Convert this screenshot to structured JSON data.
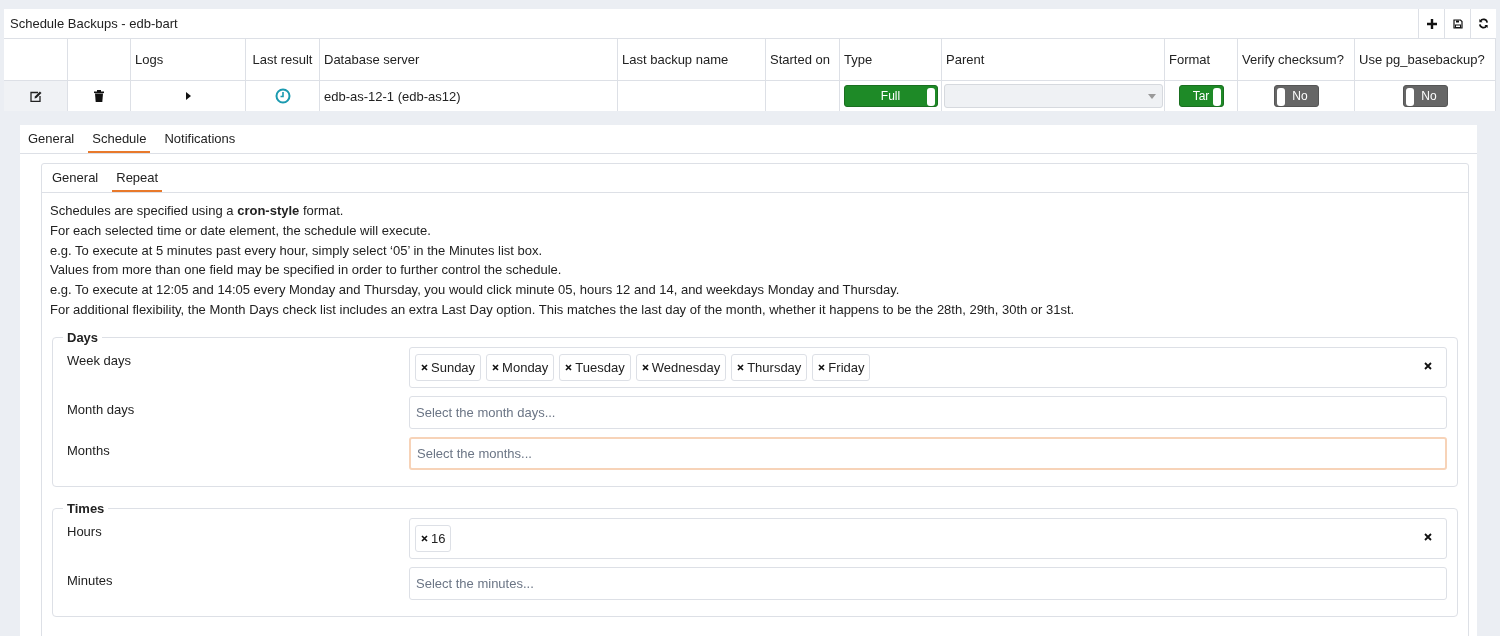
{
  "panel": {
    "title": "Schedule Backups - edb-bart"
  },
  "table": {
    "columns": [
      "Logs",
      "Last result",
      "Database server",
      "Last backup name",
      "Started on",
      "Type",
      "Parent",
      "Format",
      "Verify checksum?",
      "Use pg_basebackup?"
    ],
    "row": {
      "server": "edb-as-12-1 (edb-as12)",
      "type": {
        "label": "Full",
        "on": true
      },
      "parent": {
        "disabled": true
      },
      "format": {
        "label": "Tar",
        "on": true
      },
      "verify_checksum": {
        "label": "No",
        "on": false
      },
      "use_pg_basebackup": {
        "label": "No",
        "on": false
      }
    }
  },
  "tabs": [
    {
      "label": "General",
      "selected": false
    },
    {
      "label": "Schedule",
      "selected": true
    },
    {
      "label": "Notifications",
      "selected": false
    }
  ],
  "subtabs": [
    {
      "label": "General",
      "selected": false
    },
    {
      "label": "Repeat",
      "selected": true
    }
  ],
  "description": [
    "Schedules are specified using a **cron-style** format.",
    "For each selected time or date element, the schedule will execute.",
    "e.g. To execute at 5 minutes past every hour, simply select ‘05’ in the Minutes list box.",
    "Values from more than one field may be specified in order to further control the schedule.",
    "e.g. To execute at 12:05 and 14:05 every Monday and Thursday, you would click minute 05, hours 12 and 14, and weekdays Monday and Thursday.",
    "For additional flexibility, the Month Days check list includes an extra Last Day option. This matches the last day of the month, whether it happens to be the 28th, 29th, 30th or 31st."
  ],
  "fieldsets": [
    {
      "legend": "Days",
      "fields": [
        {
          "label": "Week days",
          "tags": [
            "Sunday",
            "Monday",
            "Tuesday",
            "Wednesday",
            "Thursday",
            "Friday"
          ],
          "focused": false
        },
        {
          "label": "Month days",
          "placeholder": "Select the month days...",
          "focused": false
        },
        {
          "label": "Months",
          "placeholder": "Select the months...",
          "focused": true
        }
      ]
    },
    {
      "legend": "Times",
      "fields": [
        {
          "label": "Hours",
          "tags": [
            "16"
          ],
          "focused": false
        },
        {
          "label": "Minutes",
          "placeholder": "Select the minutes...",
          "focused": false
        }
      ]
    }
  ]
}
